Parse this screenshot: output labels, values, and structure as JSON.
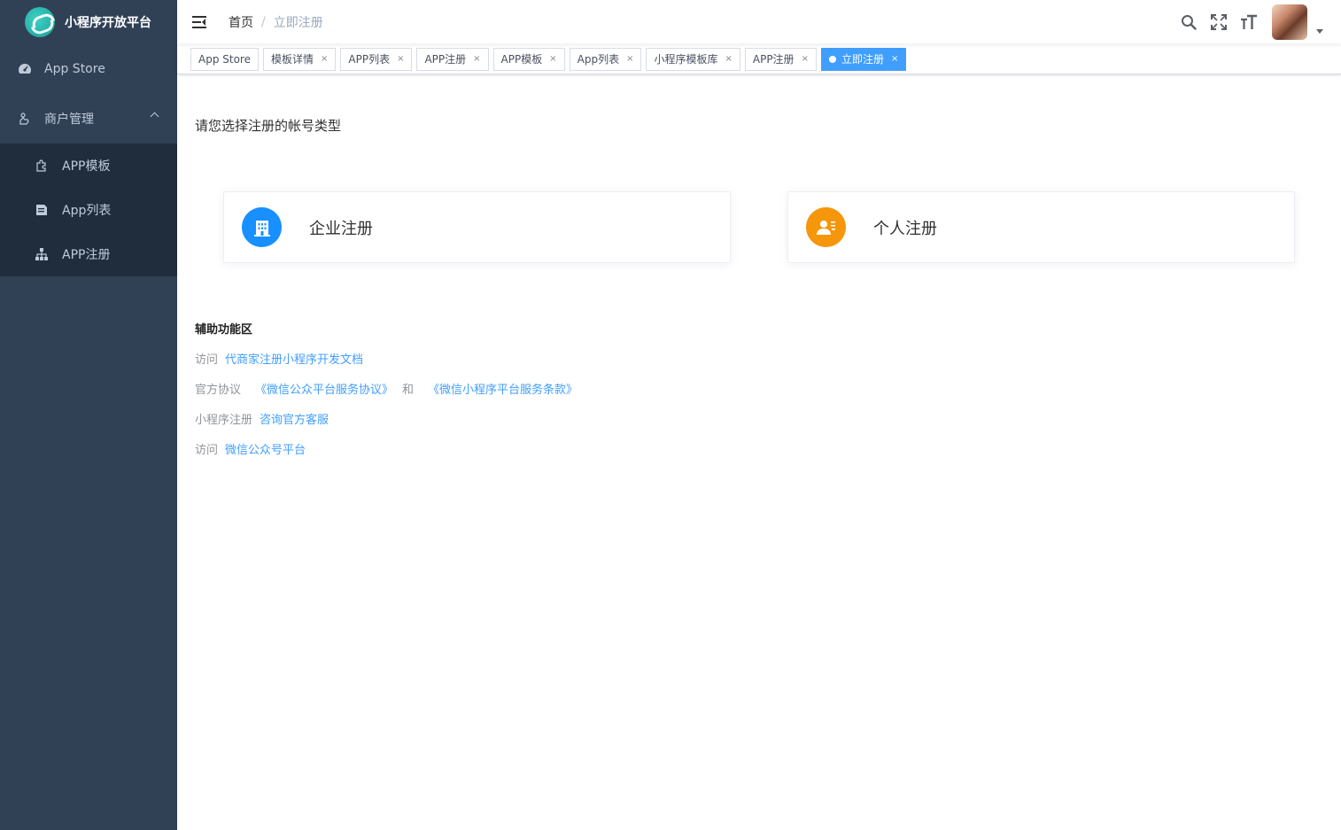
{
  "app": {
    "title": "小程序开放平台"
  },
  "sidebar": {
    "items": [
      {
        "label": "App Store",
        "icon": "dashboard-icon"
      },
      {
        "label": "商户管理",
        "icon": "user-hand-icon",
        "expanded": true
      }
    ],
    "subitems": [
      {
        "label": "APP模板",
        "icon": "puzzle-icon"
      },
      {
        "label": "App列表",
        "icon": "document-icon"
      },
      {
        "label": "APP注册",
        "icon": "tree-icon"
      }
    ]
  },
  "breadcrumb": {
    "home": "首页",
    "separator": "/",
    "current": "立即注册"
  },
  "tags": [
    {
      "label": "App Store",
      "closable": false
    },
    {
      "label": "模板详情",
      "closable": true
    },
    {
      "label": "APP列表",
      "closable": true
    },
    {
      "label": "APP注册",
      "closable": true
    },
    {
      "label": "APP模板",
      "closable": true
    },
    {
      "label": "App列表",
      "closable": true
    },
    {
      "label": "小程序模板库",
      "closable": true
    },
    {
      "label": "APP注册",
      "closable": true
    },
    {
      "label": "立即注册",
      "closable": true,
      "active": true
    }
  ],
  "tag_close_glyph": "×",
  "main": {
    "prompt": "请您选择注册的帐号类型",
    "cards": [
      {
        "label": "企业注册",
        "icon": "building-icon",
        "color": "#1890ff"
      },
      {
        "label": "个人注册",
        "icon": "person-card-icon",
        "color": "#f5960b"
      }
    ]
  },
  "aux": {
    "title": "辅助功能区",
    "row1": {
      "prefix": "访问",
      "link": "代商家注册小程序开发文档"
    },
    "row2": {
      "prefix": "官方协议",
      "link1": "《微信公众平台服务协议》",
      "mid": "和",
      "link2": "《微信小程序平台服务条款》"
    },
    "row3": {
      "prefix": "小程序注册",
      "link": "咨询官方客服"
    },
    "row4": {
      "prefix": "访问",
      "link": "微信公众号平台"
    }
  },
  "colors": {
    "sidebar": "#304156",
    "submenu": "#1f2d3d",
    "accent": "#409eff",
    "orange": "#f5960b"
  }
}
